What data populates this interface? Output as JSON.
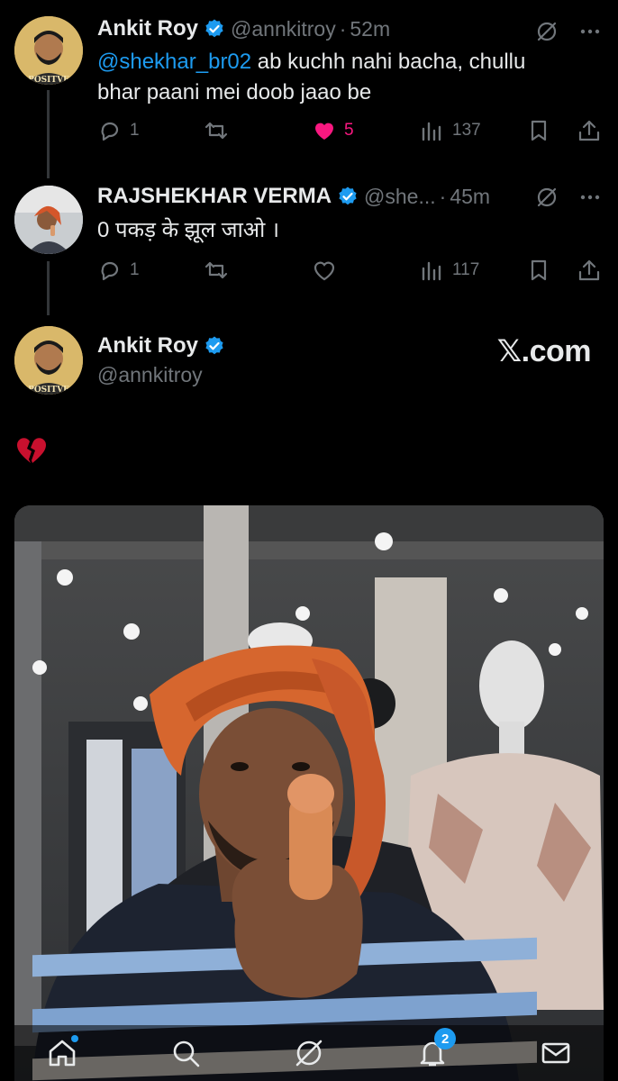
{
  "tweets": [
    {
      "name": "Ankit Roy",
      "handle": "@annkitroy",
      "dot": "·",
      "time": "52m",
      "mention": "@shekhar_br02",
      "text_line1": " ab kuchh nahi bacha, chullu",
      "text_line2": "bhar paani mei doob jaao be",
      "replies": "1",
      "likes": "5",
      "views": "137"
    },
    {
      "name": "RAJSHEKHAR VERMA",
      "handle": "@she...",
      "dot": "·",
      "time": "45m",
      "text": "0  पकड़ के झूल जाओ ।",
      "replies": "1",
      "views": "117"
    }
  ],
  "main_tweet": {
    "name": "Ankit Roy",
    "handle": "@annkitroy",
    "watermark": "𝕏.com"
  },
  "avatar_text": "POSITVE",
  "nav": {
    "notifications_badge": "2"
  },
  "colors": {
    "accent": "#1d9bf0",
    "like": "#f91880",
    "muted": "#71767b"
  },
  "icons": [
    "reply-icon",
    "retweet-icon",
    "heart-icon",
    "views-icon",
    "bookmark-icon",
    "share-icon",
    "grok-icon",
    "more-icon",
    "home-icon",
    "search-icon",
    "notifications-icon",
    "messages-icon",
    "broken-heart-emoji"
  ]
}
